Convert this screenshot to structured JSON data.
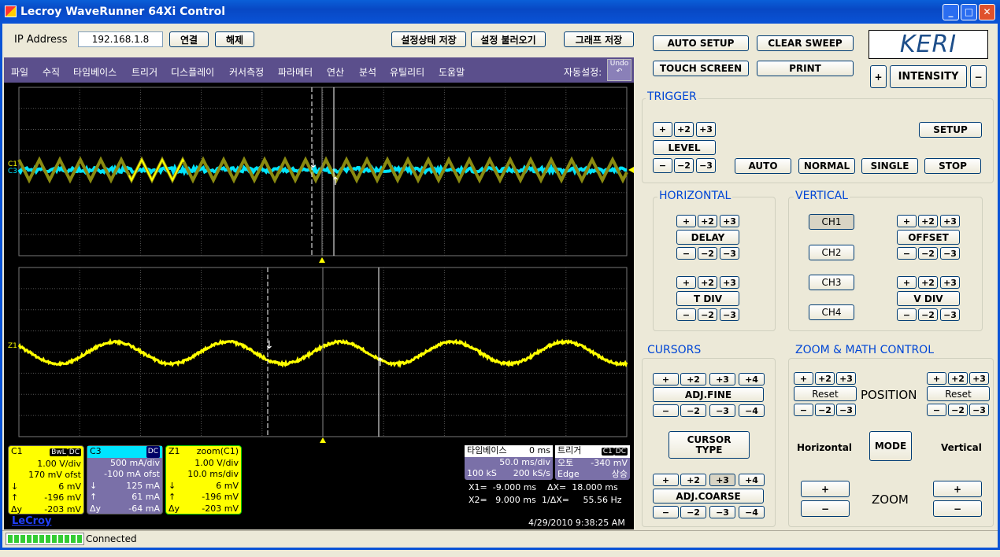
{
  "window": {
    "title": "Lecroy WaveRunner 64Xi Control",
    "minimize": "_",
    "maximize": "□",
    "close": "✕"
  },
  "toolbar": {
    "ip_label": "IP Address",
    "ip_value": "192.168.1.8",
    "connect": "연결",
    "disconnect": "해제",
    "save_settings": "설정상태 저장",
    "load_settings": "설정 불러오기",
    "save_graph": "그래프 저장"
  },
  "menu": {
    "items": [
      "파일",
      "수직",
      "타임베이스",
      "트리거",
      "디스플레이",
      "커서측정",
      "파라메터",
      "연산",
      "분석",
      "유틸리티",
      "도움말"
    ],
    "auto_setup_label": "자동설정:",
    "undo": "Undo"
  },
  "scope": {
    "ch_labels": {
      "c1": "C1",
      "c3": "C3",
      "z1": "Z1"
    },
    "colors": {
      "c1": "#ffff00",
      "c3": "#00e5ff",
      "z1": "#ffff00",
      "info_c3": "#7a70a8"
    },
    "c1": {
      "name": "C1",
      "badges": [
        "BwL",
        "DC"
      ],
      "vdiv": "1.00 V/div",
      "ofst": "170 mV ofst",
      "down_sym": "↓",
      "down": "6 mV",
      "up_sym": "↑",
      "up": "-196 mV",
      "dy_sym": "Δy",
      "dy": "-203 mV"
    },
    "c3": {
      "name": "C3",
      "badge": "DC",
      "vdiv": "500 mA/div",
      "ofst": "-100 mA ofst",
      "down_sym": "↓",
      "down": "125 mA",
      "up_sym": "↑",
      "up": "61 mA",
      "dy_sym": "Δy",
      "dy": "-64 mA"
    },
    "z1": {
      "name": "Z1",
      "src": "zoom(C1)",
      "vdiv": "1.00 V/div",
      "tdiv": "10.0 ms/div",
      "down_sym": "↓",
      "down": "6 mV",
      "up_sym": "↑",
      "up": "-196 mV",
      "dy_sym": "Δy",
      "dy": "-203 mV"
    },
    "timebase": {
      "label": "타임베이스",
      "delay": "0 ms",
      "tdiv": "50.0 ms/div",
      "samples": "100 kS",
      "rate": "200 kS/s"
    },
    "trigger": {
      "label": "트리거",
      "badges": [
        "C1",
        "DC"
      ],
      "mode": "오토",
      "level": "-340 mV",
      "type": "Edge",
      "slope": "상승"
    },
    "cursors": {
      "x1": "X1=  -9.000 ms",
      "dx": "ΔX=  18.000 ms",
      "x2": "X2=   9.000 ms",
      "inv_dx": "1/ΔX=     55.56 Hz"
    },
    "timestamp": "4/29/2010 9:38:25 AM",
    "brand": "LeCroy"
  },
  "panel": {
    "auto_setup": "AUTO SETUP",
    "clear_sweep": "CLEAR SWEEP",
    "touch_screen": "TOUCH SCREEN",
    "print": "PRINT",
    "logo": "KERI",
    "plus": "+",
    "minus": "−",
    "intensity": "INTENSITY",
    "trigger": {
      "title": "TRIGGER",
      "level": "LEVEL",
      "setup": "SETUP",
      "auto": "AUTO",
      "normal": "NORMAL",
      "single": "SINGLE",
      "stop": "STOP"
    },
    "horizontal": {
      "title": "HORIZONTAL",
      "delay": "DELAY",
      "tdiv": "T DIV"
    },
    "vertical": {
      "title": "VERTICAL",
      "ch1": "CH1",
      "ch2": "CH2",
      "ch3": "CH3",
      "ch4": "CH4",
      "offset": "OFFSET",
      "vdiv": "V DIV"
    },
    "cursors": {
      "title": "CURSORS",
      "fine": "ADJ.FINE",
      "type": "CURSOR TYPE",
      "coarse": "ADJ.COARSE",
      "selected_step": "+3"
    },
    "zoom": {
      "title": "ZOOM & MATH CONTROL",
      "reset": "Reset",
      "position": "POSITION",
      "horizontal": "Horizontal",
      "vertical": "Vertical",
      "mode": "MODE",
      "zoom": "ZOOM"
    },
    "steps_plus": [
      "+",
      "+2",
      "+3",
      "+4"
    ],
    "steps_minus": [
      "−",
      "−2",
      "−3",
      "−4"
    ]
  },
  "status": {
    "text": "Connected",
    "progress": 100
  }
}
